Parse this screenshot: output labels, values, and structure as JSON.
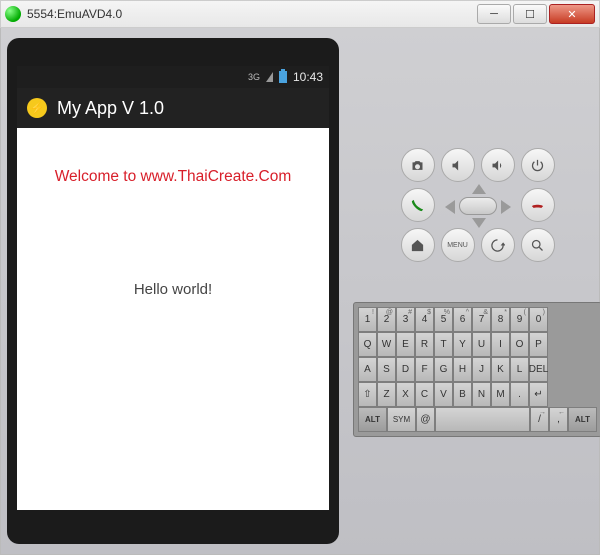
{
  "window": {
    "title": "5554:EmuAVD4.0"
  },
  "phone": {
    "status": {
      "network": "3G",
      "time": "10:43"
    },
    "appbar": {
      "title": "My App V 1.0"
    },
    "content": {
      "welcome": "Welcome to www.ThaiCreate.Com",
      "hello": "Hello world!"
    }
  },
  "controls": {
    "menu_label": "MENU"
  },
  "keyboard": {
    "row0_sup": [
      "!",
      "@",
      "#",
      "$",
      "%",
      "^",
      "&",
      "*",
      "(",
      ")"
    ],
    "row0": [
      "1",
      "2",
      "3",
      "4",
      "5",
      "6",
      "7",
      "8",
      "9",
      "0"
    ],
    "row1": [
      "Q",
      "W",
      "E",
      "R",
      "T",
      "Y",
      "U",
      "I",
      "O",
      "P"
    ],
    "row2": [
      "A",
      "S",
      "D",
      "F",
      "G",
      "H",
      "J",
      "K",
      "L"
    ],
    "row2_del": "DEL",
    "row3_shift": "⇧",
    "row3": [
      "Z",
      "X",
      "C",
      "V",
      "B",
      "N",
      "M"
    ],
    "row3_period": ".",
    "row3_enter": "↵",
    "row4": {
      "alt": "ALT",
      "sym": "SYM",
      "at": "@",
      "space": "␣",
      "slash": "/",
      "comma": ",",
      "alt2": "ALT"
    }
  }
}
